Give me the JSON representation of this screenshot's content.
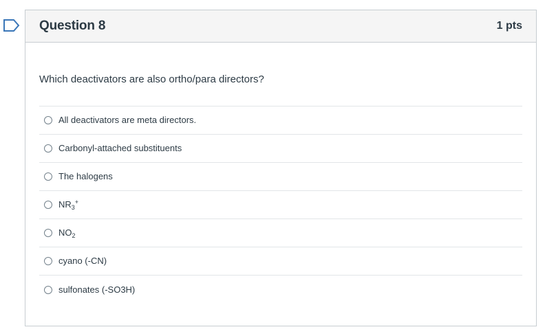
{
  "question": {
    "title": "Question 8",
    "points": "1 pts",
    "text": "Which deactivators are also ortho/para directors?"
  },
  "answers": [
    {
      "label": "All deactivators are meta directors."
    },
    {
      "label": "Carbonyl-attached substituents"
    },
    {
      "label": "The halogens"
    },
    {
      "base": "NR",
      "sub": "3",
      "sup": "+"
    },
    {
      "base": "NO",
      "sub": "2"
    },
    {
      "label": "cyano (-CN)"
    },
    {
      "label": "sulfonates (-SO3H)"
    }
  ],
  "colors": {
    "flag": "#2d3b45",
    "header_bg": "#f5f5f5",
    "border": "#c7cdd1",
    "text": "#2d3b45"
  }
}
